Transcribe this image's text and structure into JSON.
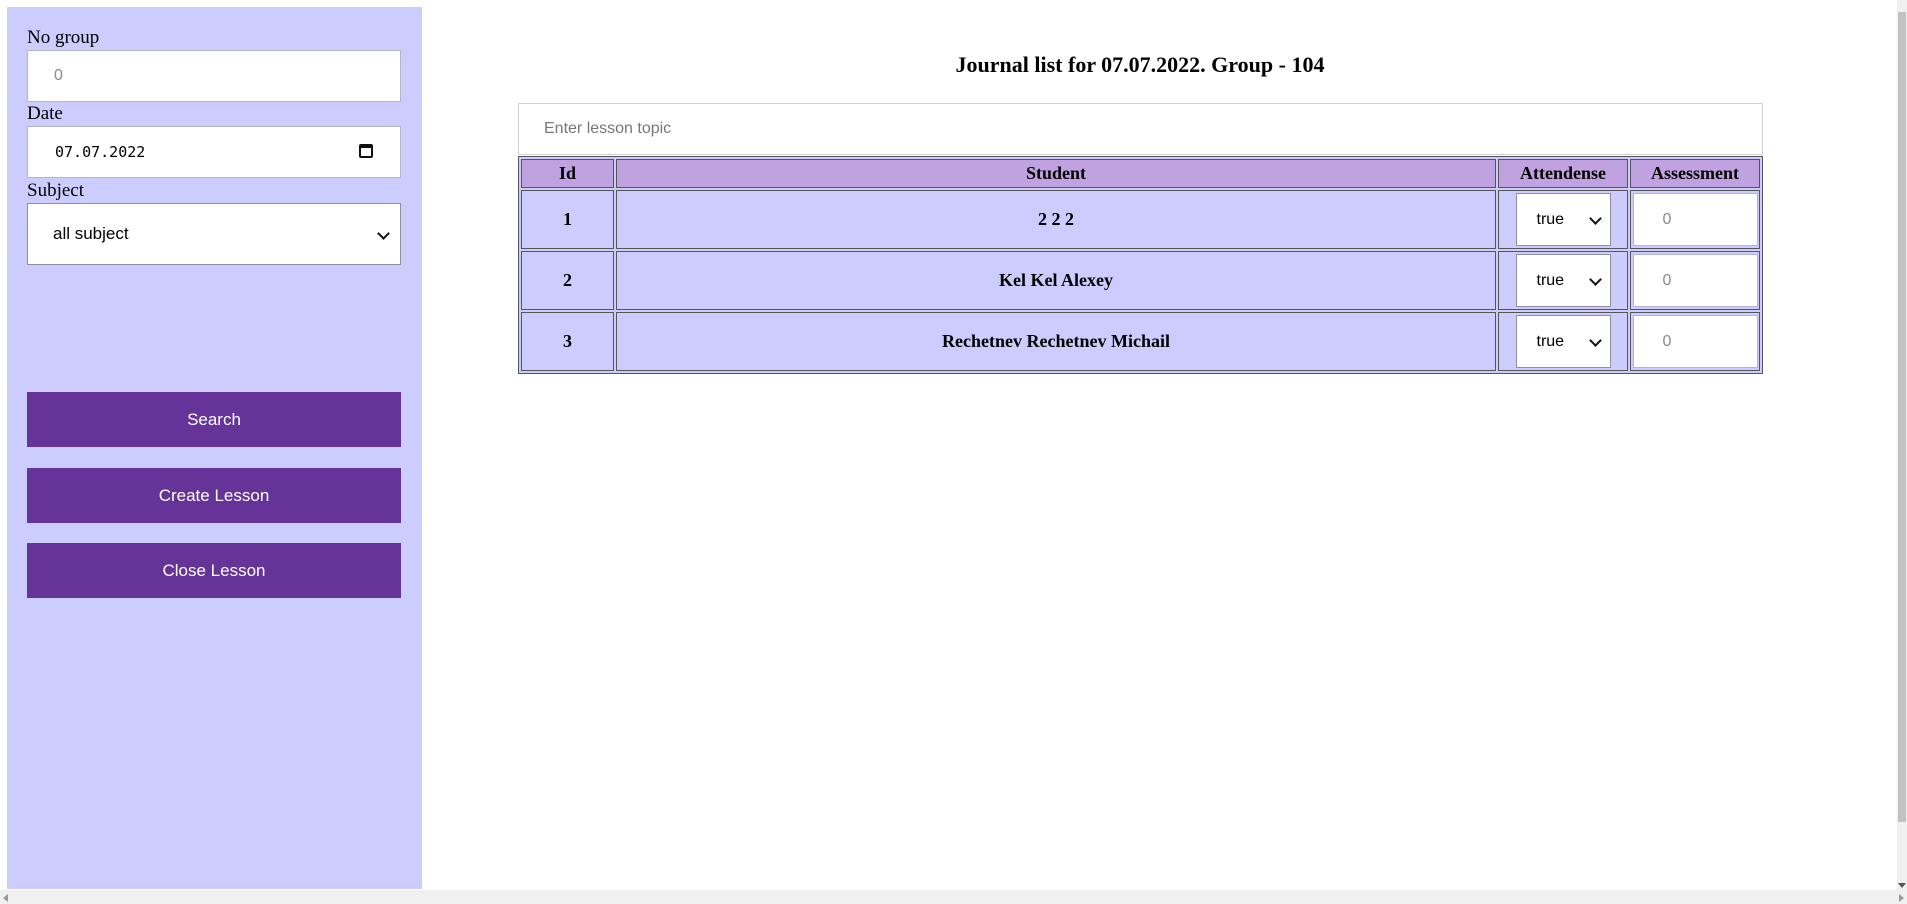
{
  "sidebar": {
    "group_label": "No group",
    "group_placeholder": "0",
    "date_label": "Date",
    "date_value": "07.07.2022",
    "subject_label": "Subject",
    "subject_value": "all subject",
    "search_label": "Search",
    "create_label": "Create Lesson",
    "close_label": "Close Lesson"
  },
  "main": {
    "title": "Journal list for 07.07.2022. Group - 104",
    "topic_placeholder": "Enter lesson topic",
    "table": {
      "headers": {
        "id": "Id",
        "student": "Student",
        "attendance": "Attendense",
        "assessment": "Assessment"
      },
      "rows": [
        {
          "id": "1",
          "student": "2 2 2",
          "attendance": "true",
          "assessment": "0"
        },
        {
          "id": "2",
          "student": "Kel Kel Alexey",
          "attendance": "true",
          "assessment": "0"
        },
        {
          "id": "3",
          "student": "Rechetnev Rechetnev Michail",
          "attendance": "true",
          "assessment": "0"
        }
      ]
    }
  },
  "colors": {
    "sidebar_bg": "#ccccff",
    "button_bg": "#663399",
    "header_bg": "#c1a2e0",
    "cell_bg": "#ccccff"
  }
}
